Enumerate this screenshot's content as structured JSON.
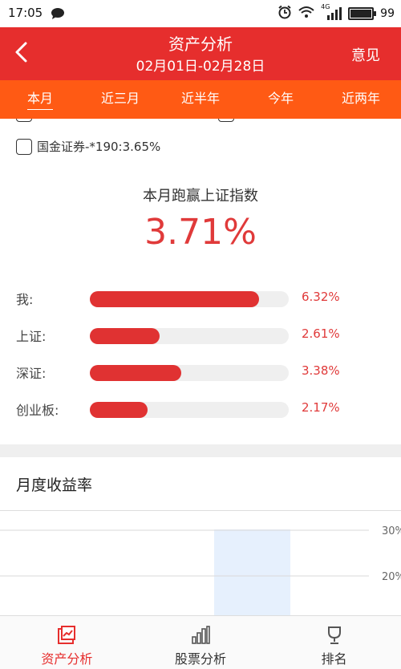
{
  "status_bar": {
    "time": "17:05",
    "network": "4G",
    "battery": "99",
    "battery_level": 0.99
  },
  "header": {
    "title": "资产分析",
    "date_range": "02月01日-02月28日",
    "feedback_label": "意见"
  },
  "tabs": [
    {
      "label": "本月",
      "active": true
    },
    {
      "label": "近三月",
      "active": false
    },
    {
      "label": "近半年",
      "active": false
    },
    {
      "label": "今年",
      "active": false
    },
    {
      "label": "近两年",
      "active": false
    }
  ],
  "brokers": [
    {
      "label": "国金证券-*190:3.65%",
      "checked": false
    }
  ],
  "summary": {
    "label": "本月跑赢上证指数",
    "value": "3.71%"
  },
  "comparisons": [
    {
      "label": "我:",
      "value": "6.32%",
      "fraction": 0.85
    },
    {
      "label": "上证:",
      "value": "2.61%",
      "fraction": 0.35
    },
    {
      "label": "深证:",
      "value": "3.38%",
      "fraction": 0.46
    },
    {
      "label": "创业板:",
      "value": "2.17%",
      "fraction": 0.29
    }
  ],
  "monthly": {
    "title": "月度收益率",
    "chart_data": {
      "type": "bar",
      "y_tick_labels": [
        "30%",
        "20%"
      ],
      "y_ticks": [
        30,
        20
      ],
      "grid": true
    }
  },
  "bottom_nav": [
    {
      "label": "资产分析",
      "icon": "asset-analysis-icon",
      "active": true
    },
    {
      "label": "股票分析",
      "icon": "stock-analysis-icon",
      "active": false
    },
    {
      "label": "排名",
      "icon": "ranking-icon",
      "active": false
    }
  ],
  "colors": {
    "header_red": "#e62e2d",
    "tab_orange": "#ff5a14",
    "value_red": "#e03a3a",
    "bar_red": "#e03232",
    "chart_highlight": "#e6f0fd"
  }
}
